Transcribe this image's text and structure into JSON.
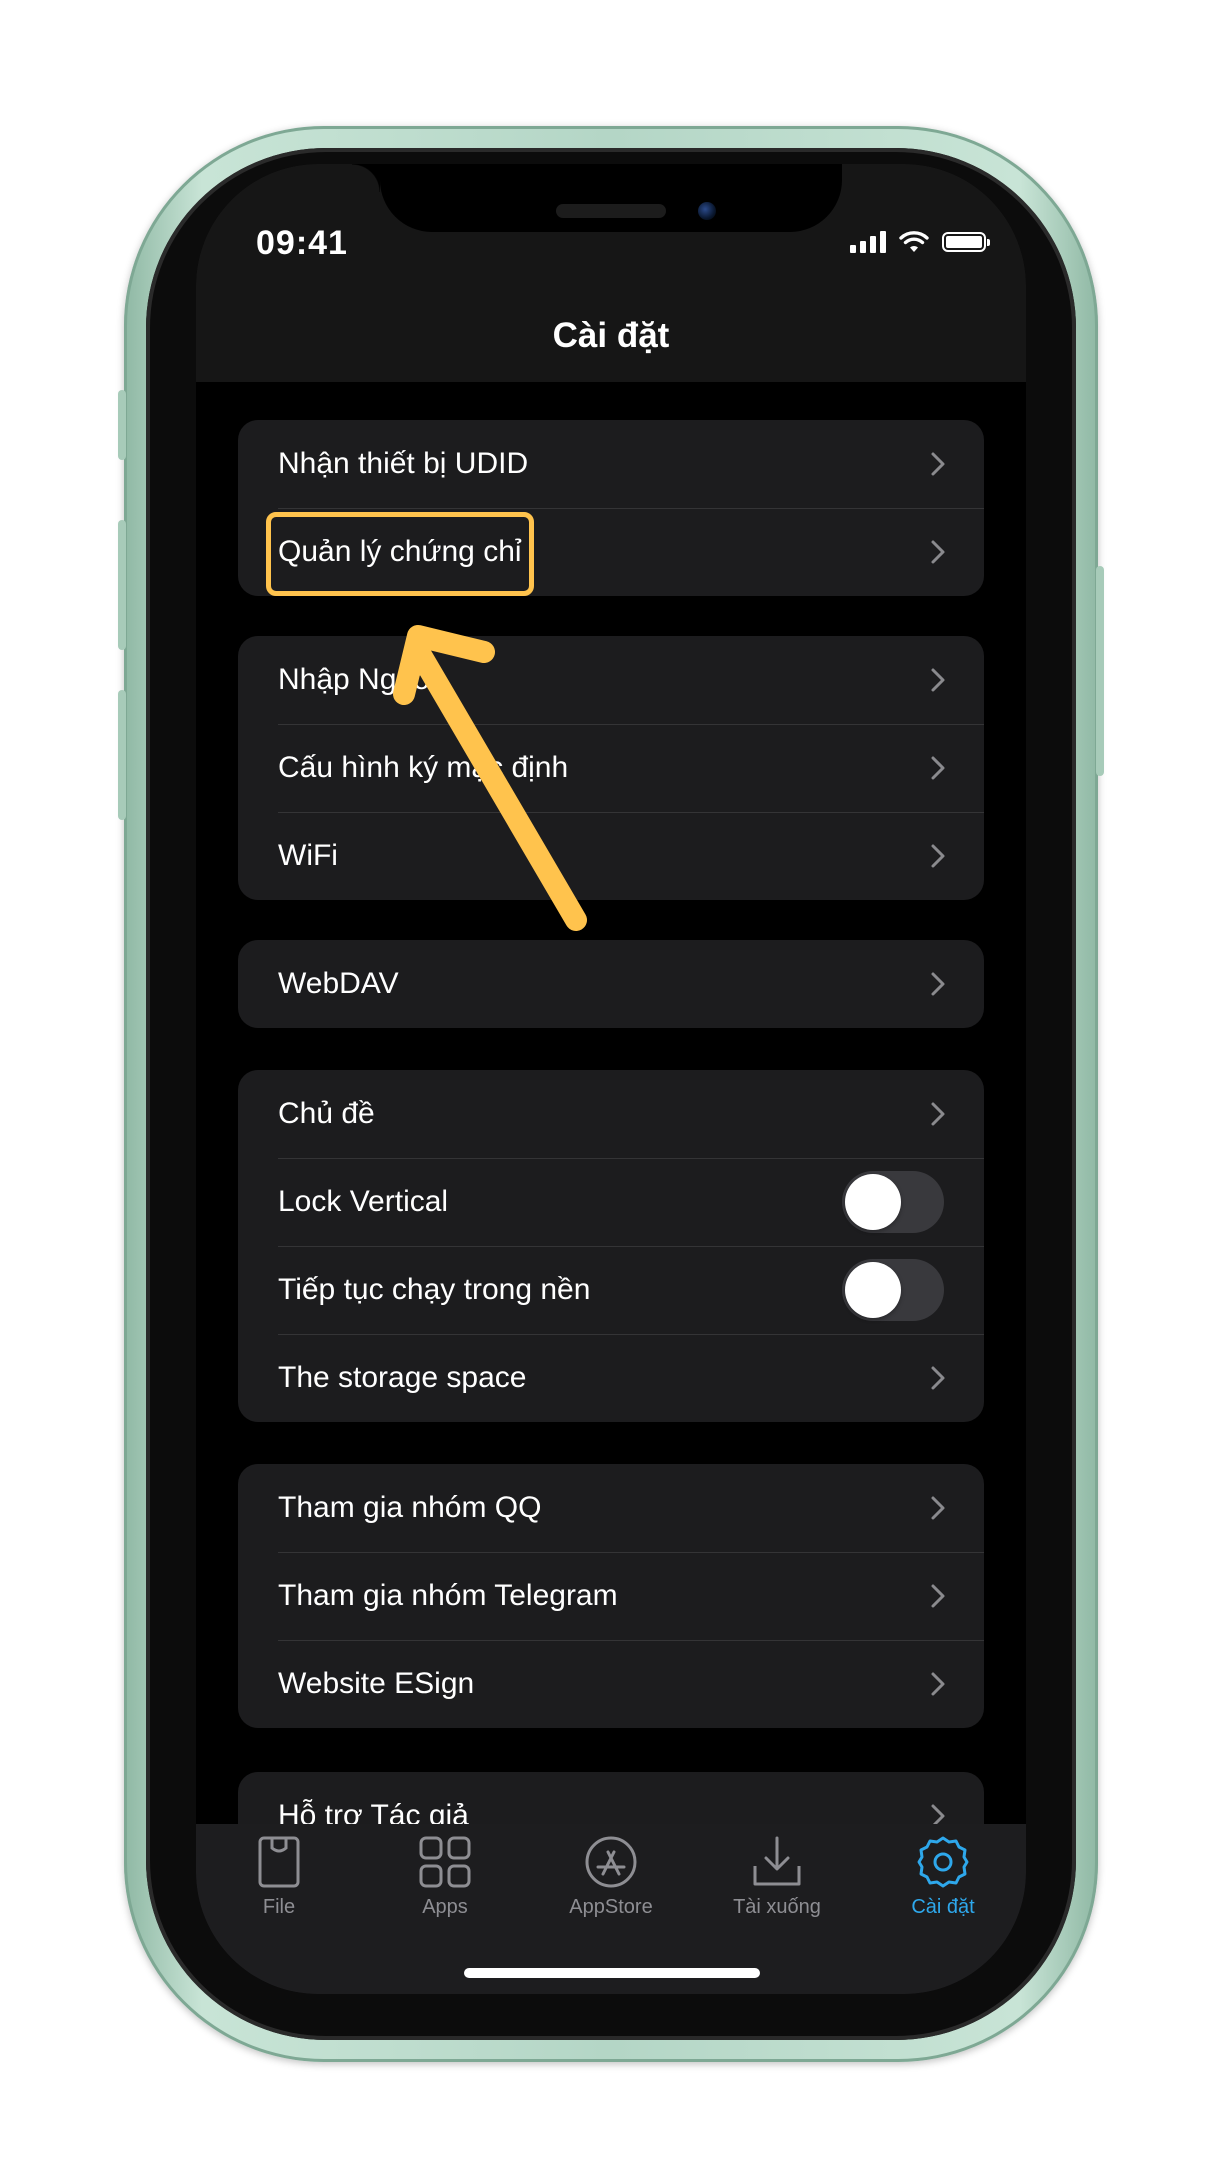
{
  "status_bar": {
    "time": "09:41"
  },
  "nav": {
    "title": "Cài đặt"
  },
  "groups": [
    {
      "rows": [
        {
          "label": "Nhận thiết bị UDID"
        },
        {
          "label": "Quản lý chứng chỉ"
        }
      ]
    },
    {
      "rows": [
        {
          "label": "Nhập Nguồn"
        },
        {
          "label": "Cấu hình ký mặc định"
        },
        {
          "label": "WiFi"
        }
      ]
    },
    {
      "rows": [
        {
          "label": "WebDAV"
        }
      ]
    },
    {
      "rows": [
        {
          "label": "Chủ đề"
        },
        {
          "label": "Lock Vertical",
          "toggle": false
        },
        {
          "label": "Tiếp tục chạy trong nền",
          "toggle": false
        },
        {
          "label": "The storage space"
        }
      ]
    },
    {
      "rows": [
        {
          "label": "Tham gia nhóm QQ"
        },
        {
          "label": "Tham gia nhóm Telegram"
        },
        {
          "label": "Website ESign"
        }
      ]
    },
    {
      "rows": [
        {
          "label": "Hỗ trợ Tác giả"
        }
      ]
    }
  ],
  "tabs": [
    {
      "label": "File",
      "icon": "file-icon",
      "active": false
    },
    {
      "label": "Apps",
      "icon": "apps-grid-icon",
      "active": false
    },
    {
      "label": "AppStore",
      "icon": "appstore-icon",
      "active": false
    },
    {
      "label": "Tài xuống",
      "icon": "download-icon",
      "active": false
    },
    {
      "label": "Cài đặt",
      "icon": "gear-icon",
      "active": true
    }
  ],
  "colors": {
    "accent": "#2ea8ec",
    "highlight": "#ffc34d",
    "row_background": "#1c1c1e",
    "frame": "#b4d6c6"
  }
}
